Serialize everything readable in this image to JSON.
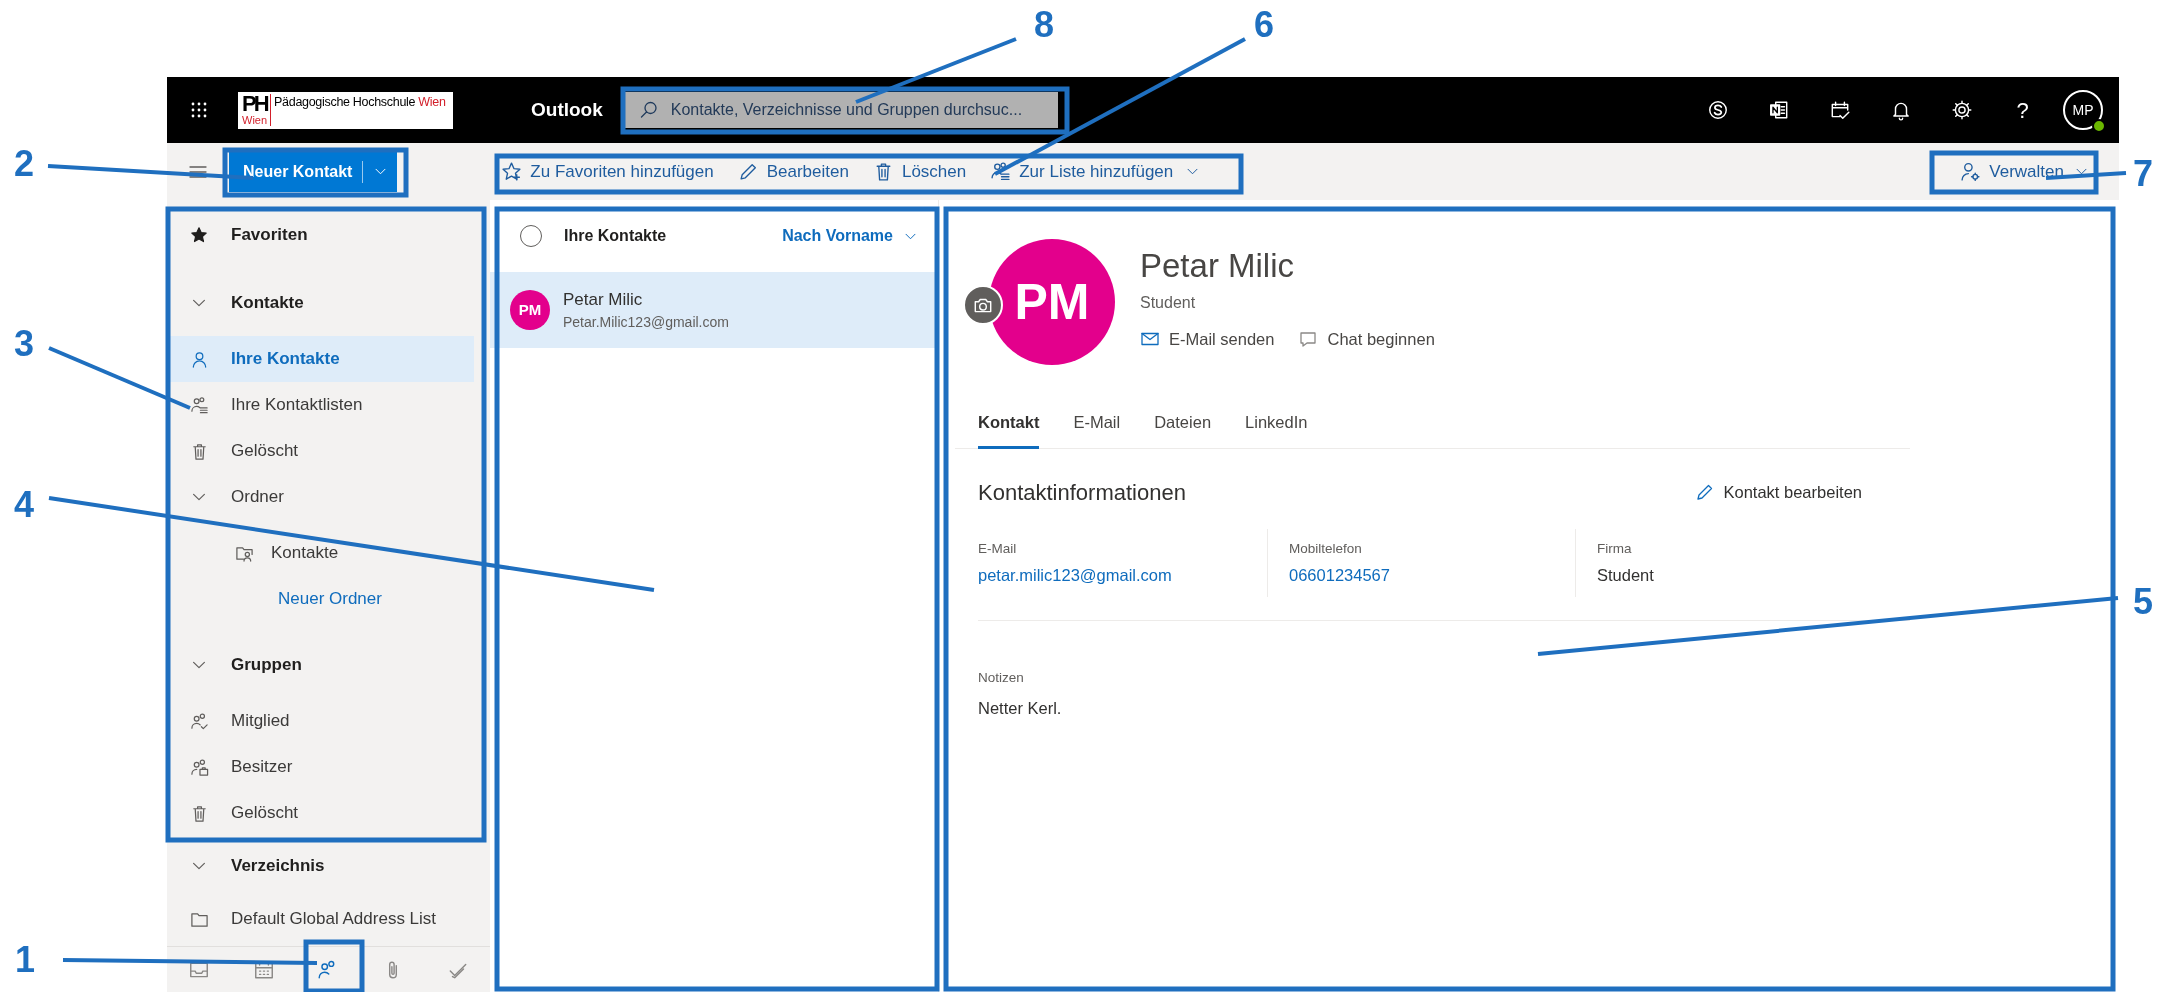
{
  "topbar": {
    "org_mark": "PH",
    "org_name": "Pädagogische Hochschule",
    "org_city": "Wien",
    "org_city_below": "Wien",
    "app_name": "Outlook",
    "search": {
      "placeholder": "Kontakte, Verzeichnisse und Gruppen durchsuc..."
    },
    "help": "?",
    "avatar": {
      "initials": "MP",
      "online": true
    }
  },
  "commands": {
    "new_button": "Neuer Kontakt",
    "actions": [
      {
        "label": "Zu Favoriten hinzufügen",
        "dropdown": false
      },
      {
        "label": "Bearbeiten",
        "dropdown": false
      },
      {
        "label": "Löschen",
        "dropdown": false
      },
      {
        "label": "Zur Liste hinzufügen",
        "dropdown": true
      }
    ],
    "manage": {
      "label": "Verwalten"
    }
  },
  "sidebar": {
    "favorites": "Favoriten",
    "sections": [
      {
        "label": "Kontakte",
        "expanded": true,
        "items": [
          {
            "label": "Ihre Kontakte",
            "kind": "item",
            "selected": true
          },
          {
            "label": "Ihre Kontaktlisten",
            "kind": "item",
            "selected": false
          },
          {
            "label": "Gelöscht",
            "kind": "item",
            "selected": false
          },
          {
            "label": "Ordner",
            "kind": "group",
            "expanded": true,
            "children": [
              {
                "label": "Kontakte",
                "kind": "folder",
                "selected": false
              },
              {
                "label": "Neuer Ordner",
                "kind": "link"
              }
            ]
          }
        ]
      },
      {
        "label": "Gruppen",
        "expanded": true,
        "items": [
          {
            "label": "Mitglied",
            "kind": "item",
            "selected": false
          },
          {
            "label": "Besitzer",
            "kind": "item",
            "selected": false
          },
          {
            "label": "Gelöscht",
            "kind": "item",
            "selected": false
          }
        ]
      },
      {
        "label": "Verzeichnis",
        "expanded": true,
        "items": [
          {
            "label": "Default Global Address List",
            "kind": "folder",
            "selected": false
          }
        ]
      }
    ],
    "bottom_nav": [
      {
        "selected": false
      },
      {
        "selected": false
      },
      {
        "selected": true
      },
      {
        "selected": false
      },
      {
        "selected": false
      }
    ]
  },
  "contact_list": {
    "header": "Ihre Kontakte",
    "select_all_checked": false,
    "sort": "Nach Vorname",
    "contacts": [
      {
        "initials": "PM",
        "name": "Petar Milic",
        "email": "Petar.Milic123@gmail.com",
        "color": "#e3008c",
        "selected": true
      }
    ]
  },
  "detail": {
    "initials": "PM",
    "color": "#e3008c",
    "name": "Petar Milic",
    "title": "Student",
    "actions": [
      "E-Mail senden",
      "Chat beginnen"
    ],
    "tabs": [
      {
        "label": "Kontakt",
        "selected": true
      },
      {
        "label": "E-Mail",
        "selected": false
      },
      {
        "label": "Dateien",
        "selected": false
      },
      {
        "label": "LinkedIn",
        "selected": false
      }
    ],
    "section_title": "Kontaktinformationen",
    "edit_link": "Kontakt bearbeiten",
    "fields": [
      {
        "label": "E-Mail",
        "value": "petar.milic123@gmail.com",
        "kind": "link"
      },
      {
        "label": "Mobiltelefon",
        "value": "06601234567",
        "kind": "link"
      },
      {
        "label": "Firma",
        "value": "Student",
        "kind": "text"
      }
    ],
    "notes": {
      "label": "Notizen",
      "value": "Netter Kerl."
    }
  },
  "annotations": [
    {
      "label": "8"
    },
    {
      "label": "6"
    },
    {
      "label": "2"
    },
    {
      "label": "7"
    },
    {
      "label": "3"
    },
    {
      "label": "4"
    },
    {
      "label": "5"
    },
    {
      "label": "1"
    }
  ]
}
